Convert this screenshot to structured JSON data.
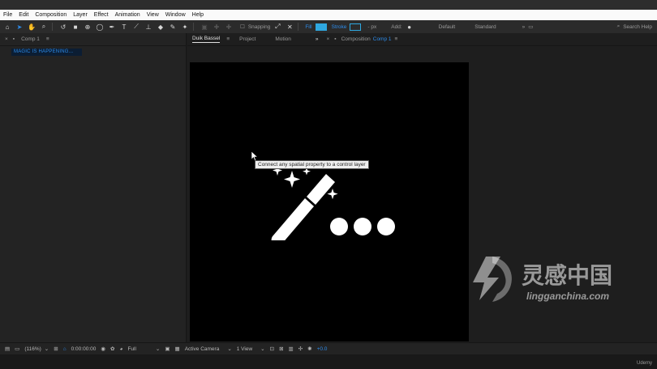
{
  "menu": [
    "File",
    "Edit",
    "Composition",
    "Layer",
    "Effect",
    "Animation",
    "View",
    "Window",
    "Help"
  ],
  "toolbar": {
    "snapping_label": "Snapping",
    "fill_label": "Fill",
    "stroke_label": "Stroke",
    "stroke_px": "- px",
    "add_label": "Add:",
    "workspaces": [
      "Default",
      "Standard"
    ],
    "search_placeholder": "Search Help",
    "fill_color": "#2fa8e0",
    "accent_color": "#2d8ceb"
  },
  "left_panel": {
    "tab_label": "Comp 1",
    "status_text": "MAGIC IS HAPPENING..."
  },
  "center_panel": {
    "tabs": [
      "Duik Bassel",
      "Project",
      "Motion"
    ],
    "composition_prefix": "Composition",
    "composition_name": "Comp 1"
  },
  "viewer": {
    "tooltip": "Connect any spatial property to a control layer"
  },
  "watermark": {
    "chinese": "灵感中国",
    "url": "lingganchina.com"
  },
  "bottom_bar": {
    "zoom": "(116%)",
    "timecode": "0:00:00:00",
    "resolution": "Full",
    "camera": "Active Camera",
    "views": "1 View",
    "exposure": "+0.0"
  },
  "footer": {
    "brand": "Udemy"
  }
}
